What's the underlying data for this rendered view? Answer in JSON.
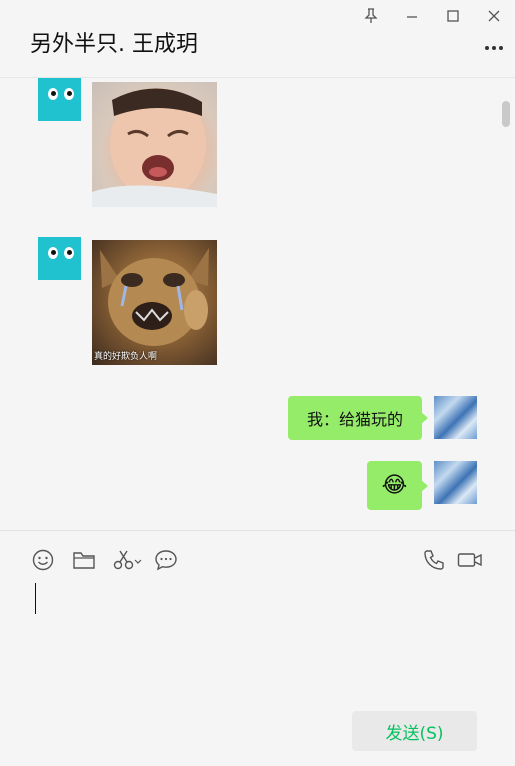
{
  "window": {
    "title": "另外半只. 王成玥"
  },
  "messages": [
    {
      "side": "left",
      "type": "sticker",
      "caption": ""
    },
    {
      "side": "left",
      "type": "sticker",
      "caption": "真的好欺负人啊"
    },
    {
      "side": "right",
      "type": "text",
      "text": "我：给猫玩的"
    },
    {
      "side": "right",
      "type": "emoji",
      "text": "😂"
    }
  ],
  "composer": {
    "send_label": "发送(S)"
  },
  "colors": {
    "bubble_self": "#95ec69",
    "send_text": "#07c160",
    "avatar_teal": "#1fc2ce"
  },
  "icons": [
    "pin-icon",
    "minimize-icon",
    "maximize-icon",
    "close-icon",
    "more-icon",
    "emoji-icon",
    "folder-icon",
    "scissors-icon",
    "chat-history-icon",
    "phone-icon",
    "video-call-icon"
  ]
}
